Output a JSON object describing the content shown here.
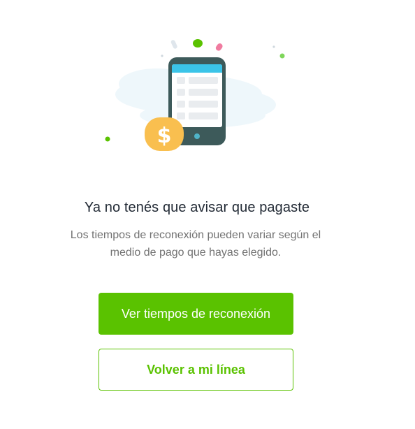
{
  "message": {
    "title": "Ya no tenés que avisar que pagaste",
    "subtitle": "Los tiempos de reconexión pueden variar según el medio de pago que hayas elegido."
  },
  "actions": {
    "primary_label": "Ver tiempos de reconexión",
    "secondary_label": "Volver a mi línea"
  },
  "colors": {
    "accent": "#5ac200",
    "title": "#222a35",
    "body_text": "#727272",
    "phone_body": "#3d5a5a",
    "phone_screen_header": "#3bc4e8",
    "coin": "#f9bf4f"
  },
  "illustration": {
    "icon": "phone-payment-illustration",
    "coin_symbol": "$"
  }
}
